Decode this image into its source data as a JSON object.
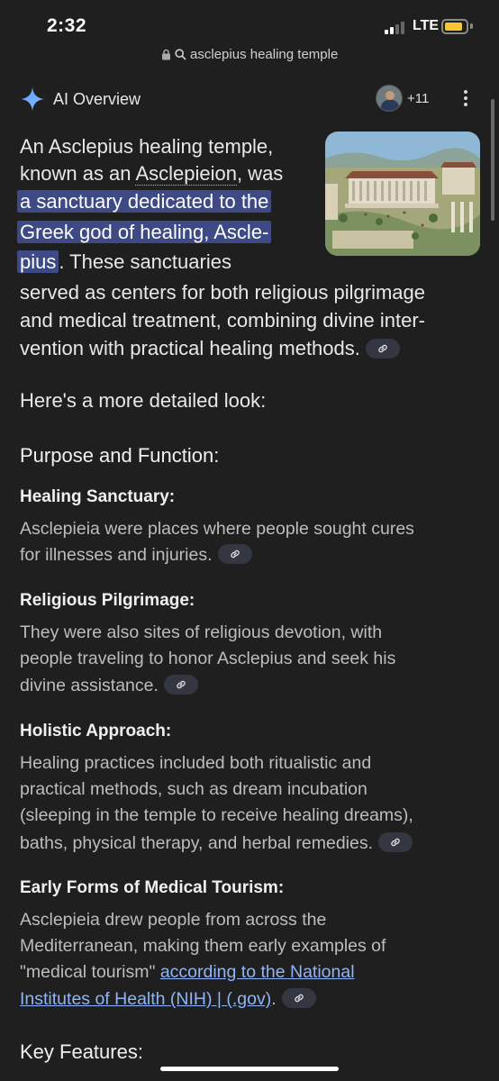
{
  "status": {
    "time": "2:32",
    "network": "LTE"
  },
  "url_bar": {
    "query": "asclepius healing temple"
  },
  "overview": {
    "title": "AI Overview",
    "contributors": "+11"
  },
  "intro": {
    "l1": "An Asclepius healing temple,",
    "l2_a": "known as an ",
    "l2_term": "Asclepieion",
    "l2_b": ", was",
    "l3": "a sanctuary dedicated to the",
    "l4": "Greek god of healing, Ascle-",
    "l5_hl": "pius",
    "l5_b": ". These sanctuaries",
    "l6": "served as centers for both religious pilgrimage",
    "l7": "and medical treatment, combining divine inter-",
    "l8": "vention with practical healing methods."
  },
  "detail_intro": "Here's a more detailed look:",
  "section1_title": "Purpose and Function:",
  "items": {
    "healing": {
      "heading": "Healing Sanctuary:",
      "l1": "Asclepieia were places where people sought cures",
      "l2": "for illnesses and injuries."
    },
    "pilgrimage": {
      "heading": "Religious Pilgrimage:",
      "l1": "They were also sites of religious devotion, with",
      "l2": "people traveling to honor Asclepius and seek his",
      "l3": "divine assistance."
    },
    "holistic": {
      "heading": "Holistic Approach:",
      "l1": "Healing practices included both ritualistic and",
      "l2": "practical methods, such as dream incubation",
      "l3": "(sleeping in the temple to receive healing dreams),",
      "l4": "baths, physical therapy, and herbal remedies."
    },
    "tourism": {
      "heading": "Early Forms of Medical Tourism:",
      "l1": "Asclepieia drew people from across the",
      "l2": "Mediterranean, making them early examples of",
      "l3_a": "\"medical tourism\" ",
      "l3_link": "according to the National",
      "l4_link": "Institutes of Health (NIH) | (.gov)",
      "l4_b": "."
    }
  },
  "section2_title": "Key Features:",
  "colors": {
    "background": "#1f1f1f",
    "highlight": "#3e4a86",
    "link": "#8fb4f8",
    "chip": "#343641",
    "battery": "#f7c631"
  },
  "icons": [
    "lock-icon",
    "search-icon",
    "sparkle-icon",
    "more-vert-icon",
    "link-icon"
  ]
}
